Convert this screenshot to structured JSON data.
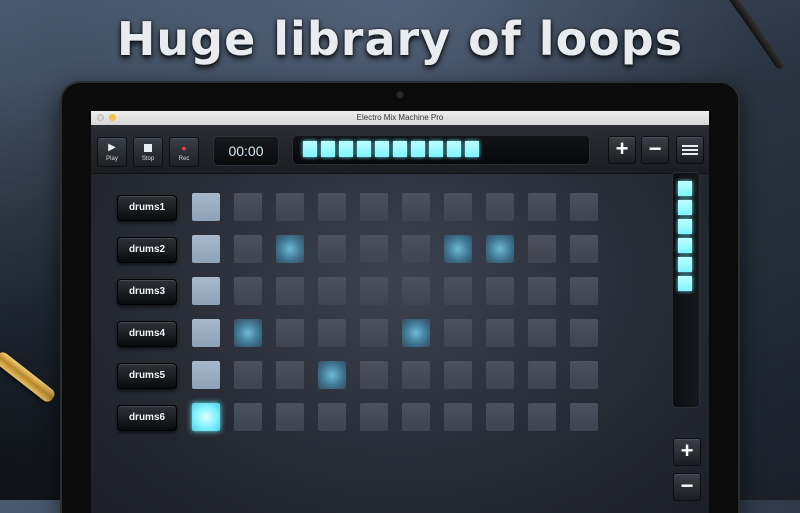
{
  "headline": "Huge library of loops",
  "window": {
    "title": "Electro Mix Machine Pro"
  },
  "toolbar": {
    "play_label": "Play",
    "stop_label": "Stop",
    "rec_label": "Rec",
    "time": "00:00",
    "progress_filled": 10,
    "progress_total": 10
  },
  "tracks": [
    {
      "label": "drums1",
      "pads": [
        "sel",
        "off",
        "off",
        "off",
        "off",
        "off",
        "off",
        "off",
        "off",
        "off"
      ]
    },
    {
      "label": "drums2",
      "pads": [
        "sel",
        "off",
        "glow",
        "off",
        "off",
        "off",
        "glow",
        "glow",
        "off",
        "off"
      ]
    },
    {
      "label": "drums3",
      "pads": [
        "sel",
        "off",
        "off",
        "off",
        "off",
        "off",
        "off",
        "off",
        "off",
        "off"
      ]
    },
    {
      "label": "drums4",
      "pads": [
        "sel",
        "glow",
        "off",
        "off",
        "off",
        "glow",
        "off",
        "off",
        "off",
        "off"
      ]
    },
    {
      "label": "drums5",
      "pads": [
        "sel",
        "off",
        "off",
        "glow",
        "off",
        "off",
        "off",
        "off",
        "off",
        "off"
      ]
    },
    {
      "label": "drums6",
      "pads": [
        "hot",
        "off",
        "off",
        "off",
        "off",
        "off",
        "off",
        "off",
        "off",
        "off"
      ]
    }
  ],
  "volume": {
    "lit_segments": 6
  },
  "icons": {
    "play": "play-icon",
    "stop": "stop-icon",
    "rec": "record-icon",
    "add": "plus-icon",
    "remove": "minus-icon",
    "mixer": "mixer-icon"
  },
  "colors": {
    "accent": "#7ff4ff",
    "pad": "#4b515d",
    "selected_pad": "#a7b8cb"
  }
}
